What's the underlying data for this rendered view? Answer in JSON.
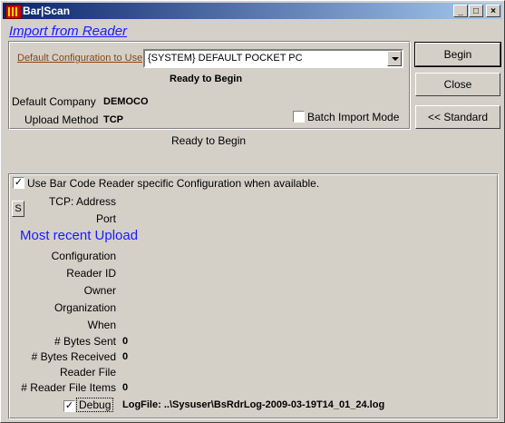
{
  "window": {
    "title": "Bar|Scan"
  },
  "header": {
    "import_title": "Import from Reader"
  },
  "config": {
    "default_config_label": "Default Configuration to Use",
    "selected_config": "{SYSTEM} DEFAULT POCKET PC",
    "status_inner": "Ready to Begin",
    "default_company_label": "Default Company",
    "default_company_value": "DEMOCO",
    "upload_method_label": "Upload Method",
    "upload_method_value": "TCP",
    "batch_import_label": "Batch Import Mode",
    "batch_import_checked": false
  },
  "buttons": {
    "begin": "Begin",
    "close": "Close",
    "standard": "<< Standard"
  },
  "status_outer": "Ready to Begin",
  "details": {
    "use_reader_config_label": "Use Bar Code Reader specific Configuration when available.",
    "use_reader_config_checked": true,
    "s_button": "S",
    "tcp_address_label": "TCP: Address",
    "port_label": "Port",
    "recent_upload_title": "Most recent Upload",
    "configuration_label": "Configuration",
    "reader_id_label": "Reader ID",
    "owner_label": "Owner",
    "organization_label": "Organization",
    "when_label": "When",
    "bytes_sent_label": "# Bytes Sent",
    "bytes_sent_value": "0",
    "bytes_received_label": "# Bytes Received",
    "bytes_received_value": "0",
    "reader_file_label": "Reader File",
    "reader_file_items_label": "# Reader File Items",
    "reader_file_items_value": "0",
    "debug_label": "Debug",
    "debug_checked": true,
    "logfile_text": "LogFile: ..\\Sysuser\\BsRdrLog-2009-03-19T14_01_24.log"
  }
}
